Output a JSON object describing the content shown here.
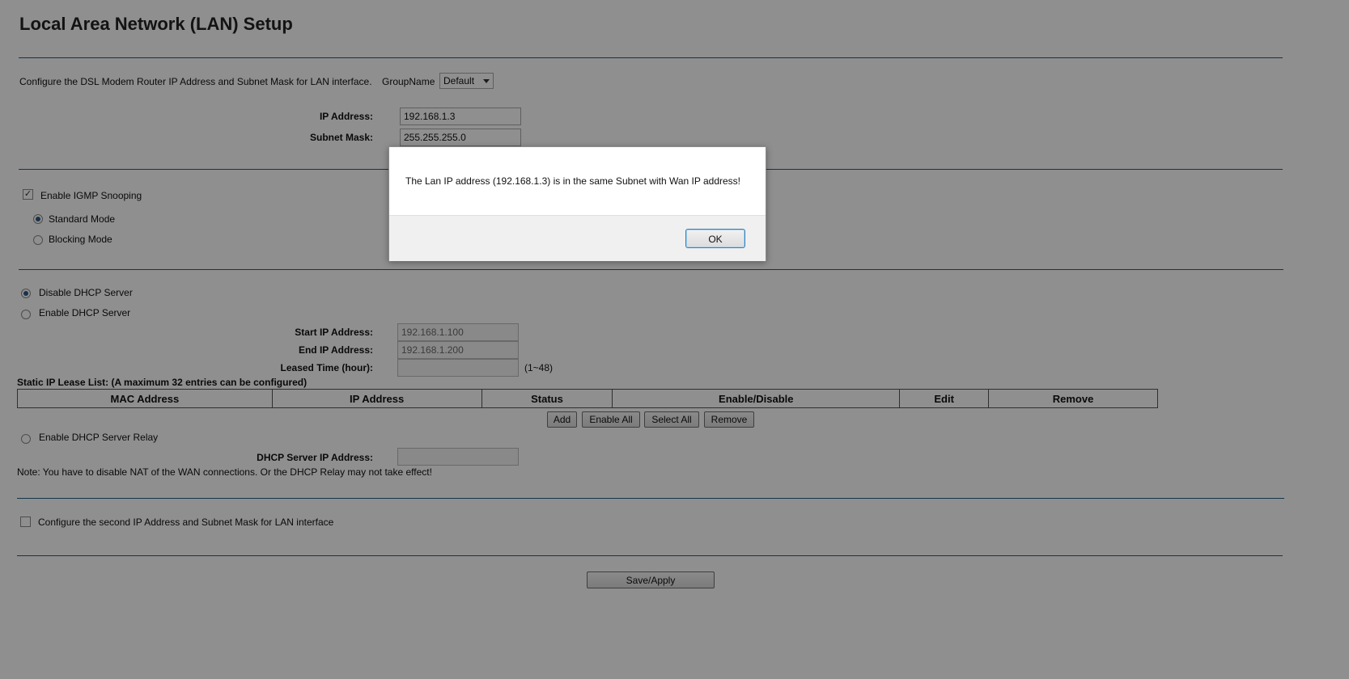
{
  "page": {
    "title": "Local Area Network (LAN) Setup",
    "intro": "Configure the DSL Modem Router IP Address and Subnet Mask for LAN interface.",
    "group_label": "GroupName",
    "group_value": "Default"
  },
  "lan": {
    "ip_label": "IP Address:",
    "ip_value": "192.168.1.3",
    "mask_label": "Subnet Mask:",
    "mask_value": "255.255.255.0"
  },
  "igmp": {
    "enable_label": "Enable IGMP Snooping",
    "enabled": true,
    "standard_label": "Standard Mode",
    "blocking_label": "Blocking Mode",
    "mode": "standard"
  },
  "dhcp": {
    "disable_label": "Disable DHCP Server",
    "enable_label": "Enable DHCP Server",
    "selected": "disable",
    "start_label": "Start IP Address:",
    "start_value": "192.168.1.100",
    "end_label": "End IP Address:",
    "end_value": "192.168.1.200",
    "lease_label": "Leased Time (hour):",
    "lease_value": "",
    "lease_range": "(1~48)"
  },
  "static_lease": {
    "caption": "Static IP Lease List: (A maximum 32 entries can be configured)",
    "columns": [
      "MAC Address",
      "IP Address",
      "Status",
      "Enable/Disable",
      "Edit",
      "Remove"
    ],
    "add_label": "Add",
    "enable_all_label": "Enable All",
    "select_all_label": "Select All",
    "remove_label": "Remove"
  },
  "relay": {
    "enable_label": "Enable DHCP Server Relay",
    "server_ip_label": "DHCP Server IP Address:",
    "server_ip_value": "",
    "note": "Note: You have to disable NAT of the WAN connections. Or the DHCP Relay may not take effect!"
  },
  "second_ip": {
    "label": "Configure the second IP Address and Subnet Mask for LAN interface",
    "checked": false
  },
  "save_label": "Save/Apply",
  "dialog": {
    "message": "The Lan IP address (192.168.1.3) is in the same Subnet with Wan IP address!",
    "ok_label": "OK"
  }
}
